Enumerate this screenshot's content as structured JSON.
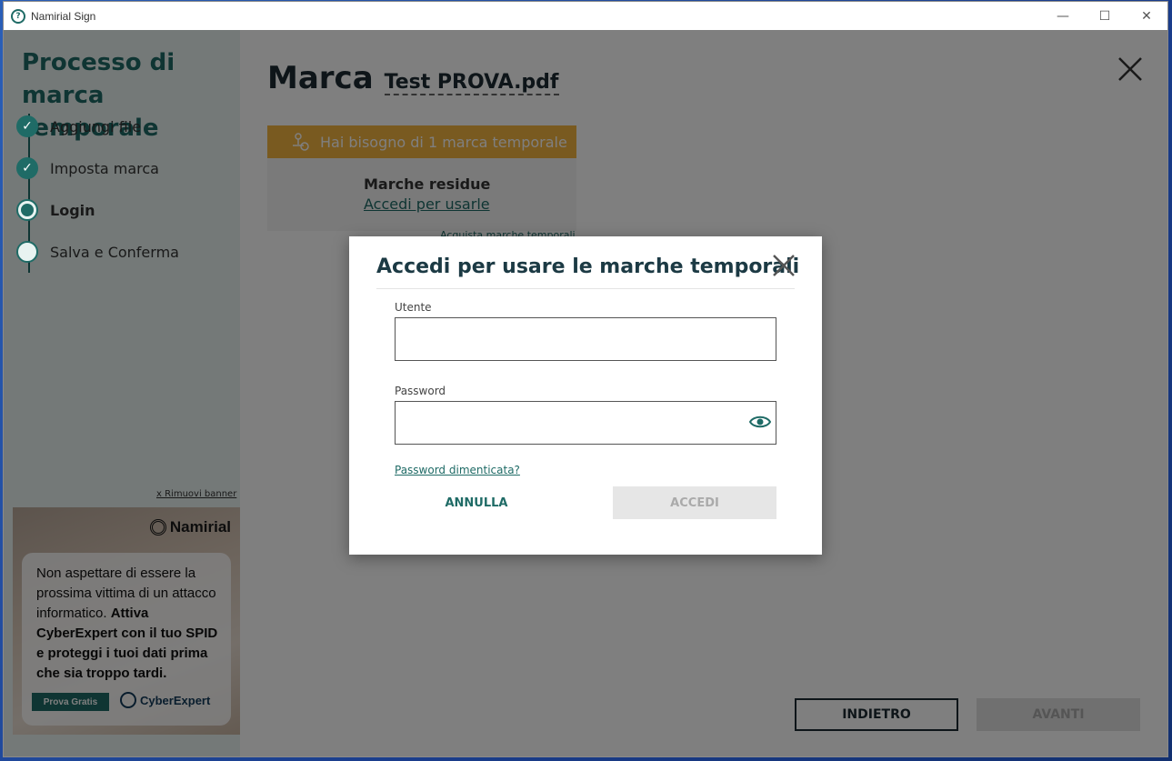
{
  "window": {
    "title": "Namirial Sign",
    "controls": {
      "minimize": "—",
      "maximize": "☐",
      "close": "✕"
    }
  },
  "sidebar": {
    "title": "Processo di marca temporale",
    "steps": [
      {
        "label": "Aggiungi file",
        "state": "done"
      },
      {
        "label": "Imposta marca",
        "state": "done"
      },
      {
        "label": "Login",
        "state": "current"
      },
      {
        "label": "Salva e Conferma",
        "state": "pending"
      }
    ],
    "remove_banner": "x Rimuovi banner"
  },
  "banner": {
    "logo": "Namirial",
    "text_plain": "Non aspettare di essere la prossima vittima di un attacco informatico.",
    "text_bold": "Attiva CyberExpert con il tuo SPID e proteggi i tuoi dati prima che sia troppo tardi.",
    "cta": "Prova Gratis",
    "brand": "CyberExpert"
  },
  "main": {
    "heading": "Marca",
    "filename": "Test PROVA.pdf",
    "need_bar": "Hai bisogno di 1 marca temporale",
    "residual_title": "Marche residue",
    "residual_link": "Accedi per usarle",
    "acquire_link": "Acquista marche temporali",
    "back_button": "INDIETRO",
    "next_button": "AVANTI"
  },
  "modal": {
    "title": "Accedi per usare le marche temporali",
    "user_label": "Utente",
    "user_value": "",
    "password_label": "Password",
    "password_value": "",
    "forgot_link": "Password dimenticata?",
    "cancel_button": "ANNULLA",
    "login_button": "ACCEDI"
  },
  "colors": {
    "primary": "#1f6b66",
    "warning": "#f3b440",
    "overlay": "rgba(0,0,0,0.5)"
  }
}
